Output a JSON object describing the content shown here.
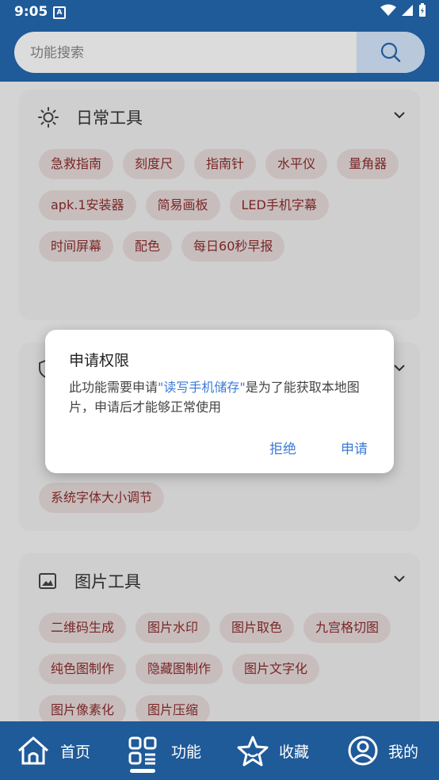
{
  "status": {
    "time": "9:05",
    "badge": "A"
  },
  "search": {
    "placeholder": "功能搜索"
  },
  "cards": [
    {
      "title": "日常工具",
      "icon": "sun-icon",
      "items": [
        "急救指南",
        "刻度尺",
        "指南针",
        "水平仪",
        "量角器",
        "apk.1安装器",
        "简易画板",
        "LED手机字幕",
        "时间屏幕",
        "配色",
        "每日60秒早报"
      ]
    },
    {
      "title": "",
      "icon": "shield-icon",
      "items": [
        "系统字体大小调节"
      ]
    },
    {
      "title": "图片工具",
      "icon": "image-icon",
      "items": [
        "二维码生成",
        "图片水印",
        "图片取色",
        "九宫格切图",
        "纯色图制作",
        "隐藏图制作",
        "图片文字化",
        "图片像素化",
        "图片压缩"
      ]
    }
  ],
  "dialog": {
    "title": "申请权限",
    "message_before": "此功能需要申请",
    "message_highlight": "\"读写手机储存\"",
    "message_after": "是为了能获取本地图片，申请后才能够正常使用",
    "deny": "拒绝",
    "allow": "申请"
  },
  "nav": [
    {
      "label": "首页",
      "icon": "home-icon"
    },
    {
      "label": "功能",
      "icon": "grid-icon",
      "active": true
    },
    {
      "label": "收藏",
      "icon": "star-icon"
    },
    {
      "label": "我的",
      "icon": "user-icon"
    }
  ],
  "colors": {
    "header": "#1f5a99",
    "chip_bg": "#e4d8d8",
    "chip_text": "#8a2c2c",
    "accent": "#3d7bd8"
  }
}
